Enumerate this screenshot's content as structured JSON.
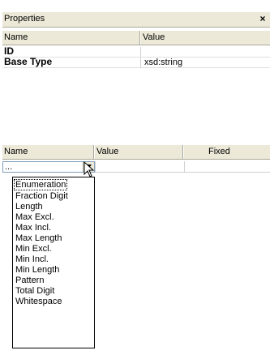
{
  "window": {
    "title": "Properties",
    "close_glyph": "×"
  },
  "properties_table": {
    "headers": [
      "Name",
      "Value"
    ],
    "rows": [
      {
        "name": "ID",
        "value": ""
      },
      {
        "name": "Base Type",
        "value": "xsd:string"
      }
    ]
  },
  "facets_table": {
    "headers": [
      "Name",
      "Value",
      "Fixed"
    ],
    "combo_value": "...",
    "options": [
      "Enumeration",
      "Fraction Digit",
      "Length",
      "Max Excl.",
      "Max Incl.",
      "Max Length",
      "Min Excl.",
      "Min Incl.",
      "Min Length",
      "Pattern",
      "Total Digit",
      "Whitespace"
    ],
    "highlighted_option": "Enumeration"
  }
}
